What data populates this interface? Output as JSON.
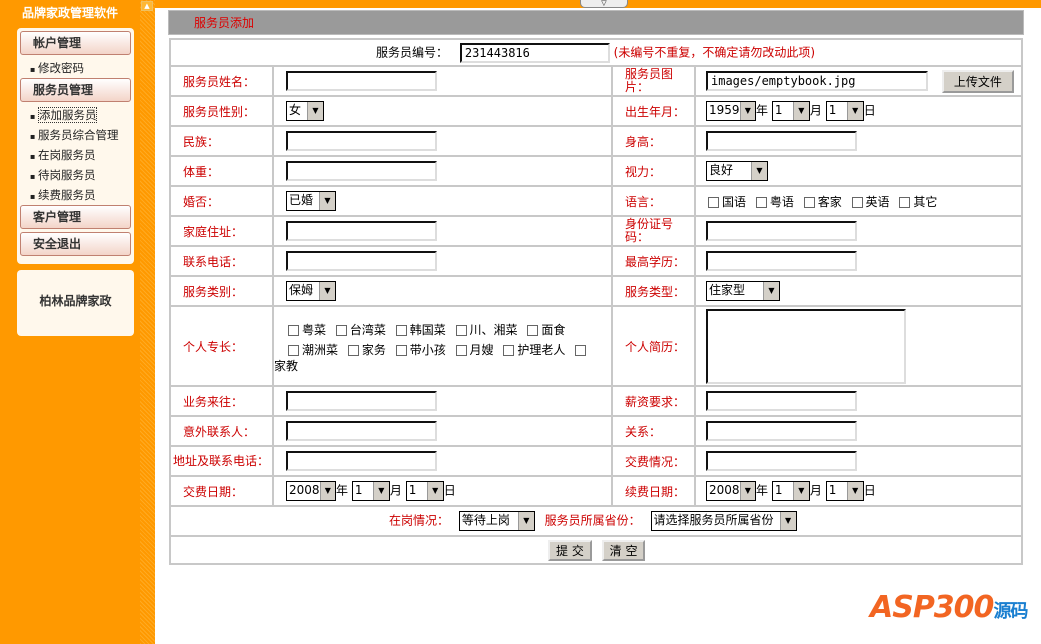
{
  "app_title": "品牌家政管理软件",
  "sidebar": {
    "groups": [
      {
        "label": "帐户管理",
        "items": [
          "修改密码"
        ]
      },
      {
        "label": "服务员管理",
        "items": [
          "添加服务员",
          "服务员综合管理",
          "在岗服务员",
          "待岗服务员",
          "续费服务员"
        ]
      },
      {
        "label": "客户管理"
      },
      {
        "label": "安全退出"
      }
    ],
    "company": "柏林品牌家政"
  },
  "panel_title": "服务员添加",
  "form": {
    "id_label": "服务员编号：",
    "id_value": "231443816",
    "id_note": "(未编号不重复，不确定请勿改动此项)",
    "name": "服务员姓名：",
    "photo": "服务员图片：",
    "photo_value": "images/emptybook.jpg",
    "upload": "上传文件",
    "gender": "服务员性别：",
    "gender_value": "女",
    "birth": "出生年月：",
    "birth_year": "1959",
    "birth_month": "1",
    "birth_day": "1",
    "year": "年",
    "month": "月",
    "day": "日",
    "ethnicity": "民族：",
    "height": "身高：",
    "weight": "体重：",
    "eyesight": "视力：",
    "eyesight_value": "良好",
    "married": "婚否：",
    "married_value": "已婚",
    "language": "语言：",
    "languages": [
      "国语",
      "粤语",
      "客家",
      "英语",
      "其它"
    ],
    "address": "家庭住址：",
    "idcard": "身份证号码：",
    "phone": "联系电话：",
    "education": "最高学历：",
    "service_cat": "服务类别：",
    "service_cat_value": "保姆",
    "service_type": "服务类型：",
    "service_type_value": "住家型",
    "skills": "个人专长：",
    "skills_list": [
      "粤菜",
      "台湾菜",
      "韩国菜",
      "川、湘菜",
      "面食",
      "潮洲菜",
      "家务",
      "带小孩",
      "月嫂",
      "护理老人",
      "家教"
    ],
    "resume": "个人简历：",
    "business": "业务来往：",
    "salary": "薪资要求：",
    "emergency": "意外联系人：",
    "relation": "关系：",
    "emg_address": "地址及联系电话：",
    "payment": "交费情况：",
    "pay_date": "交费日期：",
    "pay_year": "2008",
    "pay_month": "1",
    "pay_day": "1",
    "renew_date": "续费日期：",
    "renew_year": "2008",
    "renew_month": "1",
    "renew_day": "1",
    "status": "在岗情况：",
    "status_value": "等待上岗",
    "province": "服务员所属省份：",
    "province_value": "请选择服务员所属省份",
    "submit": "提 交",
    "clear": "清 空"
  },
  "watermark": "ASP300源码.com"
}
